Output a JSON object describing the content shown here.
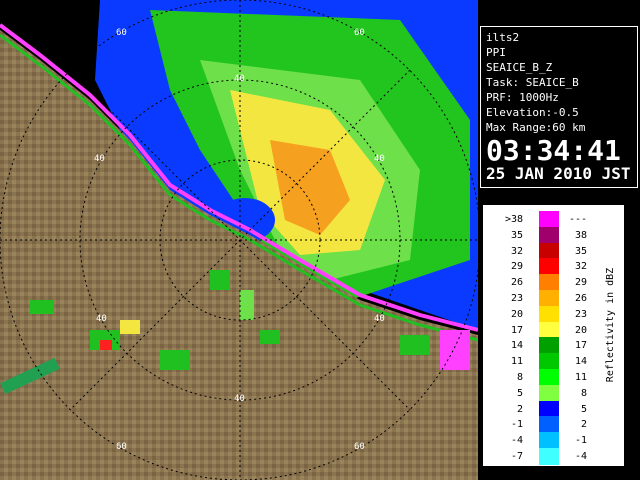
{
  "info": {
    "station": "ilts2",
    "mode": "PPI",
    "product": "SEAICE_B_Z",
    "task": "Task: SEAICE_B",
    "prf": "PRF: 1000Hz",
    "elevation": "Elevation:-0.5",
    "max_range": "Max Range:60 km",
    "time": "03:34:41",
    "date": "25 JAN 2010 JST"
  },
  "legend": {
    "title": "Reflectivity in dBZ",
    "rows": [
      {
        "lo": ">38",
        "hi": "---",
        "color": "#ff00ff"
      },
      {
        "lo": "35",
        "hi": "38",
        "color": "#a0006c"
      },
      {
        "lo": "32",
        "hi": "35",
        "color": "#c80000"
      },
      {
        "lo": "29",
        "hi": "32",
        "color": "#ff0000"
      },
      {
        "lo": "26",
        "hi": "29",
        "color": "#ff8000"
      },
      {
        "lo": "23",
        "hi": "26",
        "color": "#ffb000"
      },
      {
        "lo": "20",
        "hi": "23",
        "color": "#ffe000"
      },
      {
        "lo": "17",
        "hi": "20",
        "color": "#ffff40"
      },
      {
        "lo": "14",
        "hi": "17",
        "color": "#00a000"
      },
      {
        "lo": "11",
        "hi": "14",
        "color": "#00c800"
      },
      {
        "lo": "8",
        "hi": "11",
        "color": "#00ff00"
      },
      {
        "lo": "5",
        "hi": "8",
        "color": "#80ff40"
      },
      {
        "lo": "2",
        "hi": "5",
        "color": "#0000ff"
      },
      {
        "lo": "-1",
        "hi": "2",
        "color": "#0060ff"
      },
      {
        "lo": "-4",
        "hi": "-1",
        "color": "#00c0ff"
      },
      {
        "lo": "-7",
        "hi": "-4",
        "color": "#40ffff"
      }
    ]
  },
  "range_labels": [
    "40",
    "40",
    "40",
    "40",
    "40",
    "60",
    "60",
    "60",
    "60"
  ]
}
